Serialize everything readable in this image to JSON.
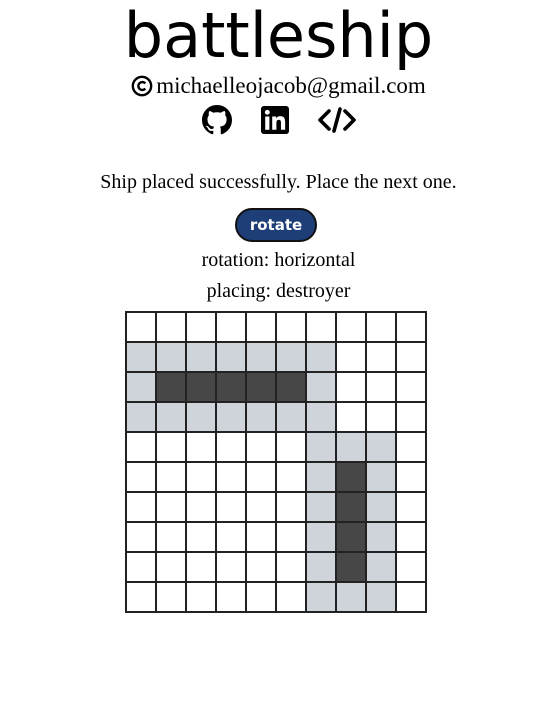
{
  "header": {
    "title": "battleship",
    "credit_email": "michaelleojacob@gmail.com"
  },
  "links": [
    {
      "name": "github",
      "icon": "github-icon"
    },
    {
      "name": "linkedin",
      "icon": "linkedin-icon"
    },
    {
      "name": "source-code",
      "icon": "code-icon"
    }
  ],
  "status": {
    "message": "Ship placed successfully. Place the next one."
  },
  "controls": {
    "rotate_label": "rotate",
    "rotation_text": "rotation: horizontal",
    "placing_text": "placing: destroyer"
  },
  "colors": {
    "button_bg": "#1d3e76",
    "ship": "#474747",
    "adjacent": "#cfd4db",
    "empty": "#ffffff",
    "grid_line": "#222222"
  },
  "board": {
    "rows": 10,
    "cols": 10,
    "cells": [
      "..........",
      "AAAAAAA...",
      "ASSSSSA...",
      "AAAAAAA...",
      "......AAA.",
      "......ASA.",
      "......ASA.",
      "......ASA.",
      "......ASA.",
      "......AAA."
    ],
    "legend": {
      "S": "ship",
      "A": "adjacent",
      ".": "empty"
    }
  }
}
